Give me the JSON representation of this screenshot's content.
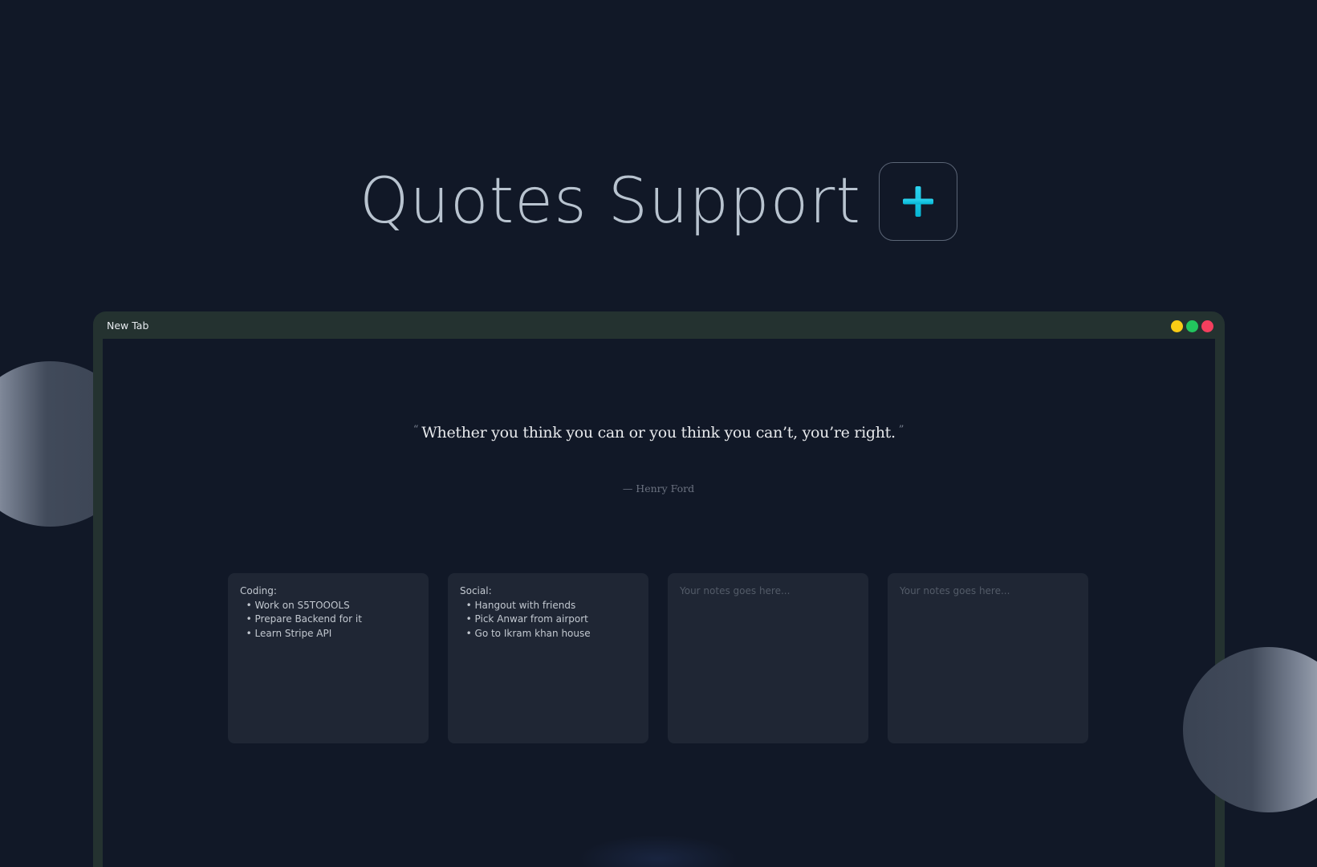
{
  "headline": {
    "title": "Quotes Support",
    "plus_icon": "plus-icon",
    "plus_color_top": "#22d3ee",
    "plus_color_bottom": "#06b6d4"
  },
  "browser": {
    "tab_title": "New Tab",
    "dots": [
      {
        "name": "yellow",
        "color": "#facc15"
      },
      {
        "name": "green",
        "color": "#22c55e"
      },
      {
        "name": "red",
        "color": "#f43f5e"
      }
    ]
  },
  "quote": {
    "open_mark": "“",
    "text": "Whether you think you can or you think you can’t, you’re right.",
    "close_mark": "”",
    "author": "— Henry Ford"
  },
  "notes": [
    {
      "lines": [
        "Coding:",
        "  • Work on S5TOOOLS",
        "  • Prepare Backend for it",
        "  • Learn Stripe API"
      ],
      "placeholder": ""
    },
    {
      "lines": [
        "Social:",
        "  • Hangout with friends",
        "  • Pick Anwar from airport",
        "  • Go to Ikram khan house"
      ],
      "placeholder": ""
    },
    {
      "lines": [],
      "placeholder": "Your notes goes here..."
    },
    {
      "lines": [],
      "placeholder": "Your notes goes here..."
    }
  ],
  "colors": {
    "background": "#111827",
    "browser_frame": "#243230",
    "note_background": "#1f2634"
  }
}
